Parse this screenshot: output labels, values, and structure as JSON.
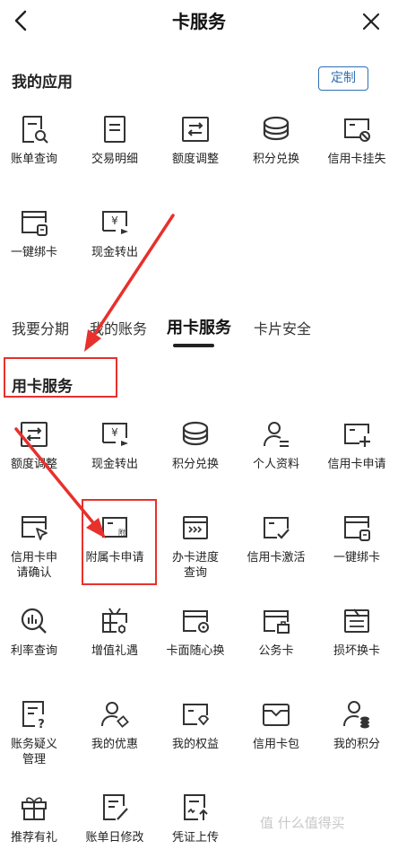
{
  "header": {
    "title": "卡服务"
  },
  "my_apps": {
    "title": "我的应用",
    "customize_label": "定制",
    "items": [
      {
        "label": "账单查询",
        "icon": "bill-search-icon"
      },
      {
        "label": "交易明细",
        "icon": "transaction-list-icon"
      },
      {
        "label": "额度调整",
        "icon": "limit-adjust-icon"
      },
      {
        "label": "积分兑换",
        "icon": "points-exchange-icon"
      },
      {
        "label": "信用卡挂失",
        "icon": "card-lost-icon"
      },
      {
        "label": "一键绑卡",
        "icon": "bind-card-icon"
      },
      {
        "label": "现金转出",
        "icon": "cash-out-icon"
      }
    ]
  },
  "tabs": [
    {
      "label": "我要分期"
    },
    {
      "label": "我的账务"
    },
    {
      "label": "用卡服务"
    },
    {
      "label": "卡片安全"
    }
  ],
  "card_services": {
    "title": "用卡服务",
    "items": [
      {
        "label": "额度调整",
        "icon": "limit-adjust-icon"
      },
      {
        "label": "现金转出",
        "icon": "cash-out-icon"
      },
      {
        "label": "积分兑换",
        "icon": "points-exchange-icon"
      },
      {
        "label": "个人资料",
        "icon": "profile-icon"
      },
      {
        "label": "信用卡申请",
        "icon": "card-apply-icon"
      },
      {
        "label": "信用卡申请确认",
        "icon": "apply-confirm-icon"
      },
      {
        "label": "附属卡申请",
        "icon": "supplementary-card-icon"
      },
      {
        "label": "办卡进度查询",
        "icon": "progress-icon"
      },
      {
        "label": "信用卡激活",
        "icon": "card-activate-icon"
      },
      {
        "label": "一键绑卡",
        "icon": "bind-card-icon"
      },
      {
        "label": "利率查询",
        "icon": "rate-query-icon"
      },
      {
        "label": "增值礼遇",
        "icon": "gift-tv-icon"
      },
      {
        "label": "卡面随心换",
        "icon": "card-face-icon"
      },
      {
        "label": "公务卡",
        "icon": "business-card-icon"
      },
      {
        "label": "损坏换卡",
        "icon": "card-replace-icon"
      },
      {
        "label": "账务疑义管理",
        "icon": "dispute-icon"
      },
      {
        "label": "我的优惠",
        "icon": "my-discount-icon"
      },
      {
        "label": "我的权益",
        "icon": "my-benefits-icon"
      },
      {
        "label": "信用卡包",
        "icon": "card-wallet-icon"
      },
      {
        "label": "我的积分",
        "icon": "my-points-icon"
      },
      {
        "label": "推荐有礼",
        "icon": "referral-gift-icon"
      },
      {
        "label": "账单日修改",
        "icon": "bill-date-edit-icon"
      },
      {
        "label": "凭证上传",
        "icon": "voucher-upload-icon"
      }
    ]
  },
  "watermark": "值 什么值得买",
  "colors": {
    "accent": "#2f6fb5",
    "annotation": "#e8302c",
    "icon": "#333333"
  }
}
